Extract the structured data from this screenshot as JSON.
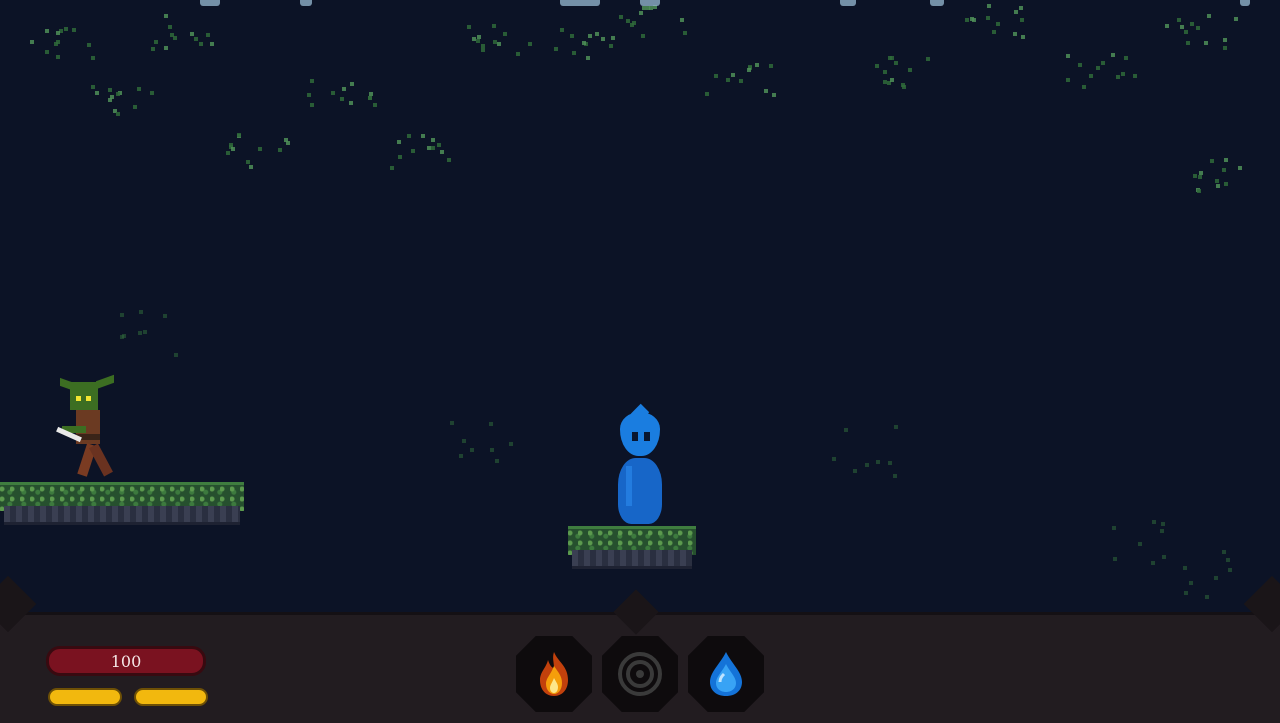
{
  "hud": {
    "health_value": "100",
    "stamina_segments": 2,
    "abilities": [
      {
        "icon": "fire-element-icon",
        "color": "#e46a17"
      },
      {
        "icon": "target-ring-icon",
        "color": "#3b3b3b"
      },
      {
        "icon": "water-element-icon",
        "color": "#1e8ff0"
      }
    ]
  },
  "colors": {
    "background": "#0c1326",
    "health": "#7a1220",
    "stamina": "#f2b80e",
    "player": "#1a7de0",
    "enemy": "#3c6e22"
  }
}
